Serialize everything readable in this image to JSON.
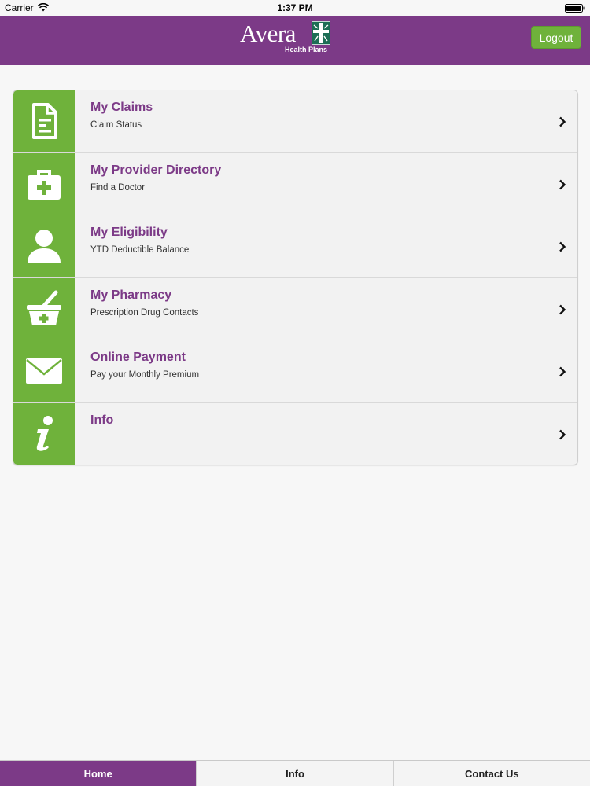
{
  "status_bar": {
    "carrier": "Carrier",
    "time": "1:37 PM"
  },
  "header": {
    "logo_word": "Avera",
    "logo_sub": "Health Plans",
    "logout_label": "Logout"
  },
  "colors": {
    "brand_purple": "#7c3a87",
    "accent_green": "#6fb23b"
  },
  "menu": {
    "items": [
      {
        "title": "My Claims",
        "subtitle": "Claim Status",
        "icon": "document-icon"
      },
      {
        "title": "My Provider Directory",
        "subtitle": "Find a Doctor",
        "icon": "medical-kit-icon"
      },
      {
        "title": "My Eligibility",
        "subtitle": "YTD Deductible Balance",
        "icon": "person-icon"
      },
      {
        "title": "My Pharmacy",
        "subtitle": "Prescription Drug Contacts",
        "icon": "mortar-pestle-icon"
      },
      {
        "title": "Online Payment",
        "subtitle": "Pay your Monthly Premium",
        "icon": "envelope-icon"
      },
      {
        "title": "Info",
        "subtitle": "",
        "icon": "info-icon"
      }
    ]
  },
  "tabs": [
    {
      "label": "Home",
      "active": true
    },
    {
      "label": "Info",
      "active": false
    },
    {
      "label": "Contact Us",
      "active": false
    }
  ]
}
